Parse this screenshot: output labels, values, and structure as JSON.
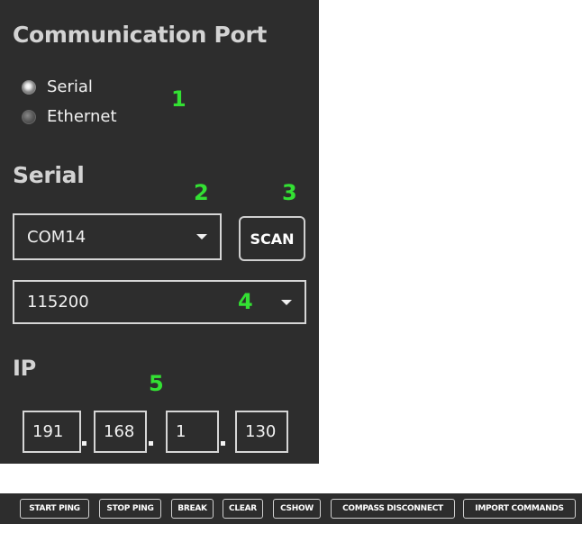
{
  "communication": {
    "title": "Communication Port",
    "options": [
      {
        "label": "Serial",
        "checked": true
      },
      {
        "label": "Ethernet",
        "checked": false
      }
    ]
  },
  "serial": {
    "title": "Serial",
    "com_port": "COM14",
    "scan_label": "SCAN",
    "baud_rate": "115200"
  },
  "ip": {
    "title": "IP",
    "octets": [
      "191",
      "168",
      "1",
      "130"
    ]
  },
  "markers": [
    "1",
    "2",
    "3",
    "4",
    "5"
  ],
  "toolbar": {
    "buttons": [
      "START PING",
      "STOP PING",
      "BREAK",
      "CLEAR",
      "CSHOW",
      "COMPASS DISCONNECT",
      "IMPORT COMMANDS"
    ]
  },
  "colors": {
    "panel_bg": "#2d2d2d",
    "heading": "#d3d3d3",
    "marker": "#33e033",
    "border": "#d6d6d6"
  }
}
